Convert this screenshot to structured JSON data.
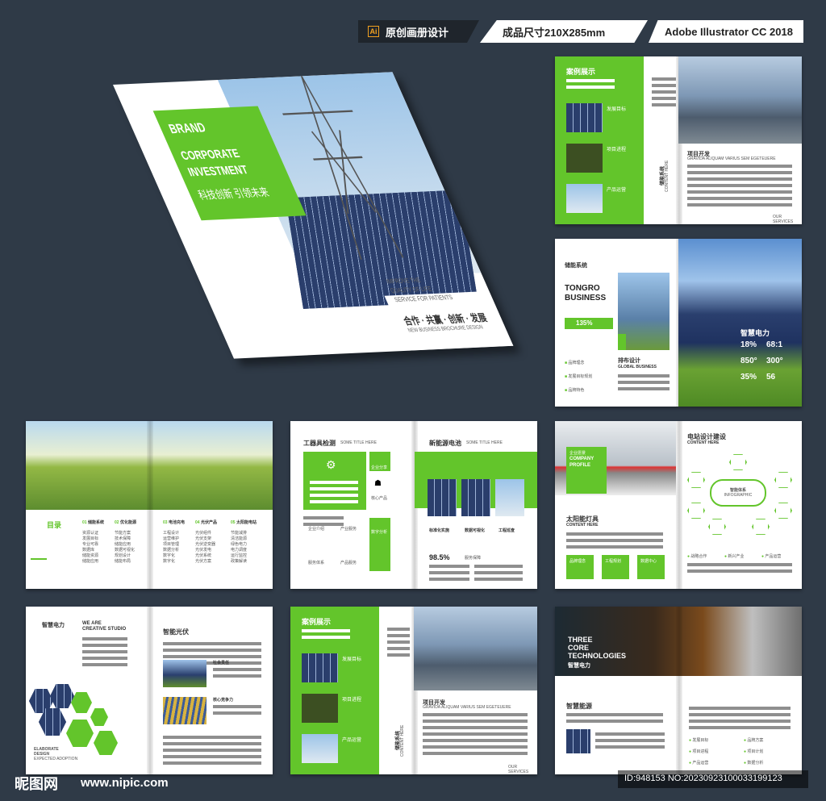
{
  "header": {
    "tag_original": "原创画册设计",
    "tag_size": "成品尺寸210X285mm",
    "tag_software": "Adobe Illustrator CC 2018",
    "ai_badge": "Ai"
  },
  "cover": {
    "brand": "BRAND",
    "title_line1": "CORPORATE",
    "title_line2": "INVESTMENT",
    "subtitle_cn": "科技创新 引领未来",
    "tagline_en1": "IMPROVE THE",
    "tagline_en2": "QUALITY OF LIFE",
    "tagline_en3": "SERVICE FOR PATIENTS",
    "slogan_cn": "合作 · 共赢 · 创新 · 发展",
    "slogan_en": "NEW BUSINESS BROCHURE DESIGN"
  },
  "spread_cases_top": {
    "title": "案例展示",
    "item1": "发展目标",
    "item2": "项目进程",
    "item3": "产品运营",
    "side_cn": "储能系统",
    "side_en": "CONTENT HERE",
    "project": "项目开发",
    "project_en": "GRAVIDA ALIQUAM VARIUS SEM EGETEUERE",
    "footer": "OUR SERVICES"
  },
  "spread_storage": {
    "title": "储能系统",
    "company_line1": "TONGRO",
    "company_line2": "BUSINESS",
    "percent": "135%",
    "layout_cn": "排布设计",
    "layout_en": "GLOBAL BUSINESS",
    "list": [
      "品牌理念",
      "发展目标规划",
      "品牌特色"
    ],
    "power_title": "智慧电力",
    "stats": [
      "18%",
      "68:1",
      "850°",
      "300°",
      "35%",
      "56"
    ]
  },
  "spread_toc": {
    "title": "目录",
    "columns": [
      {
        "head": "储能系统",
        "items": [
          "资源认证",
          "发展目标",
          "专业可靠",
          "数据库",
          "储能资源",
          "储能应用"
        ]
      },
      {
        "head": "优化能源",
        "items": [
          "节能方案",
          "技术保障",
          "储能应用",
          "数据可视化",
          "规划设计",
          "储能布局"
        ]
      },
      {
        "head": "电池充电",
        "items": [
          "工程设计",
          "运营维护",
          "项目管理",
          "数据分析",
          "数字化",
          "数字化"
        ]
      },
      {
        "head": "光伏产品",
        "items": [
          "光伏组件",
          "光伏支架",
          "光伏逆变器",
          "光伏发电",
          "光伏系统",
          "光伏方案"
        ]
      },
      {
        "head": "太阳能电站",
        "items": [
          "节能减排",
          "清洁能源",
          "绿色电力",
          "电力调度",
          "运行监控",
          "政策解读"
        ]
      }
    ]
  },
  "spread_tools": {
    "title": "工器具检测",
    "title_en": "SOME TITLE HERE",
    "title_right": "新能源电池",
    "title_right_en": "SOME TITLE HERE",
    "labels": [
      "企业分享",
      "企业介绍",
      "产业服务",
      "服务体系",
      "产品服务",
      "核心产品",
      "数字分析"
    ],
    "captions": [
      "标准化实施",
      "数据可视化",
      "工程巡查"
    ],
    "percent": "98.5%",
    "service": "服务保障"
  },
  "spread_station": {
    "vision": "企业愿景",
    "company_profile_1": "COMPANY",
    "company_profile_2": "PROFILE",
    "title": "电站设计建设",
    "title_en": "CONTENT HERE",
    "center": "智能体系",
    "center_en": "INFOGRAPHIC",
    "lamp": "太阳能灯具",
    "lamp_en": "CONTENT HERE",
    "buttons": [
      "品牌理念",
      "工程规划",
      "数据中心"
    ],
    "legend": [
      "战略合作",
      "新兴产业",
      "产品运营"
    ]
  },
  "spread_creative": {
    "label": "智慧电力",
    "we_are": "WE ARE",
    "studio": "CREATIVE STUDIO",
    "title": "智能光伏",
    "item1": "社会责任",
    "item2": "核心竞争力",
    "footer_en1": "ELABORATE",
    "footer_en2": "DESIGN",
    "footer_en3": "EXPECTED ADOPTION"
  },
  "spread_cases_bottom": {
    "title": "案例展示",
    "item1": "发展目标",
    "item2": "项目进程",
    "item3": "产品运营",
    "side_cn": "储能系统",
    "side_en": "CONTENT HERE",
    "project": "项目开发",
    "project_en": "GRAVIDA ALIQUAM VARIUS SEM EGETEUERE",
    "footer": "OUR SERVICES"
  },
  "spread_tech": {
    "line1": "THREE",
    "line2": "CORE",
    "line3": "TECHNOLOGIES",
    "cn": "智慧电力",
    "section": "智慧能源",
    "list": [
      "发展目标",
      "项目进程",
      "产品运营",
      "品牌方案",
      "项目计划",
      "数据分析"
    ]
  },
  "watermark": {
    "site": "昵图网",
    "url": "www.nipic.com",
    "id": "ID:948153 NO:20230923100033199123"
  },
  "colors": {
    "accent": "#63c52b",
    "background": "#2f3a47"
  }
}
